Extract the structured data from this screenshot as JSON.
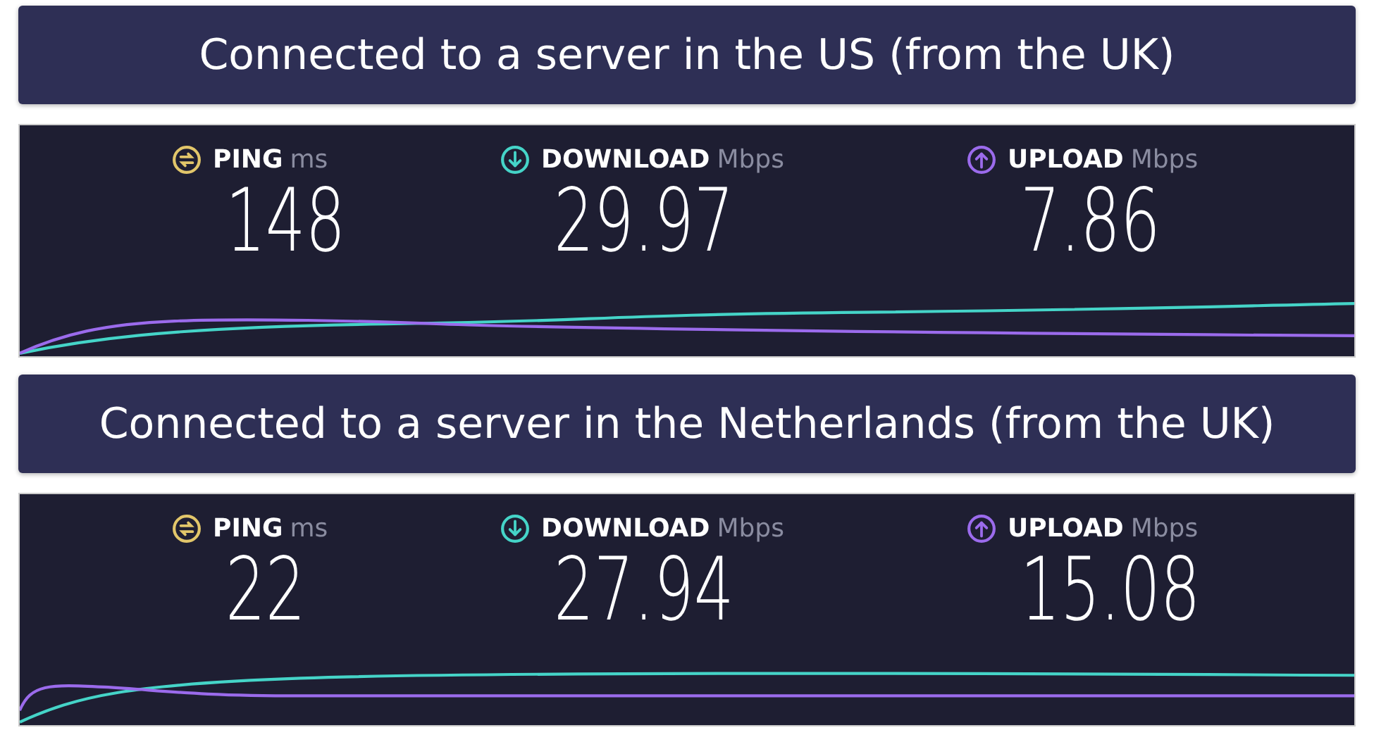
{
  "sections": [
    {
      "title": "Connected to a server in the US (from the UK)",
      "metrics": [
        {
          "kind": "ping",
          "label": "PING",
          "unit": "ms",
          "value": "148"
        },
        {
          "kind": "download",
          "label": "DOWNLOAD",
          "unit": "Mbps",
          "value": "29.97"
        },
        {
          "kind": "upload",
          "label": "UPLOAD",
          "unit": "Mbps",
          "value": "7.86"
        }
      ]
    },
    {
      "title": "Connected to a server in the Netherlands (from the UK)",
      "metrics": [
        {
          "kind": "ping",
          "label": "PING",
          "unit": "ms",
          "value": "22"
        },
        {
          "kind": "download",
          "label": "DOWNLOAD",
          "unit": "Mbps",
          "value": "27.94"
        },
        {
          "kind": "upload",
          "label": "UPLOAD",
          "unit": "Mbps",
          "value": "15.08"
        }
      ]
    }
  ]
}
